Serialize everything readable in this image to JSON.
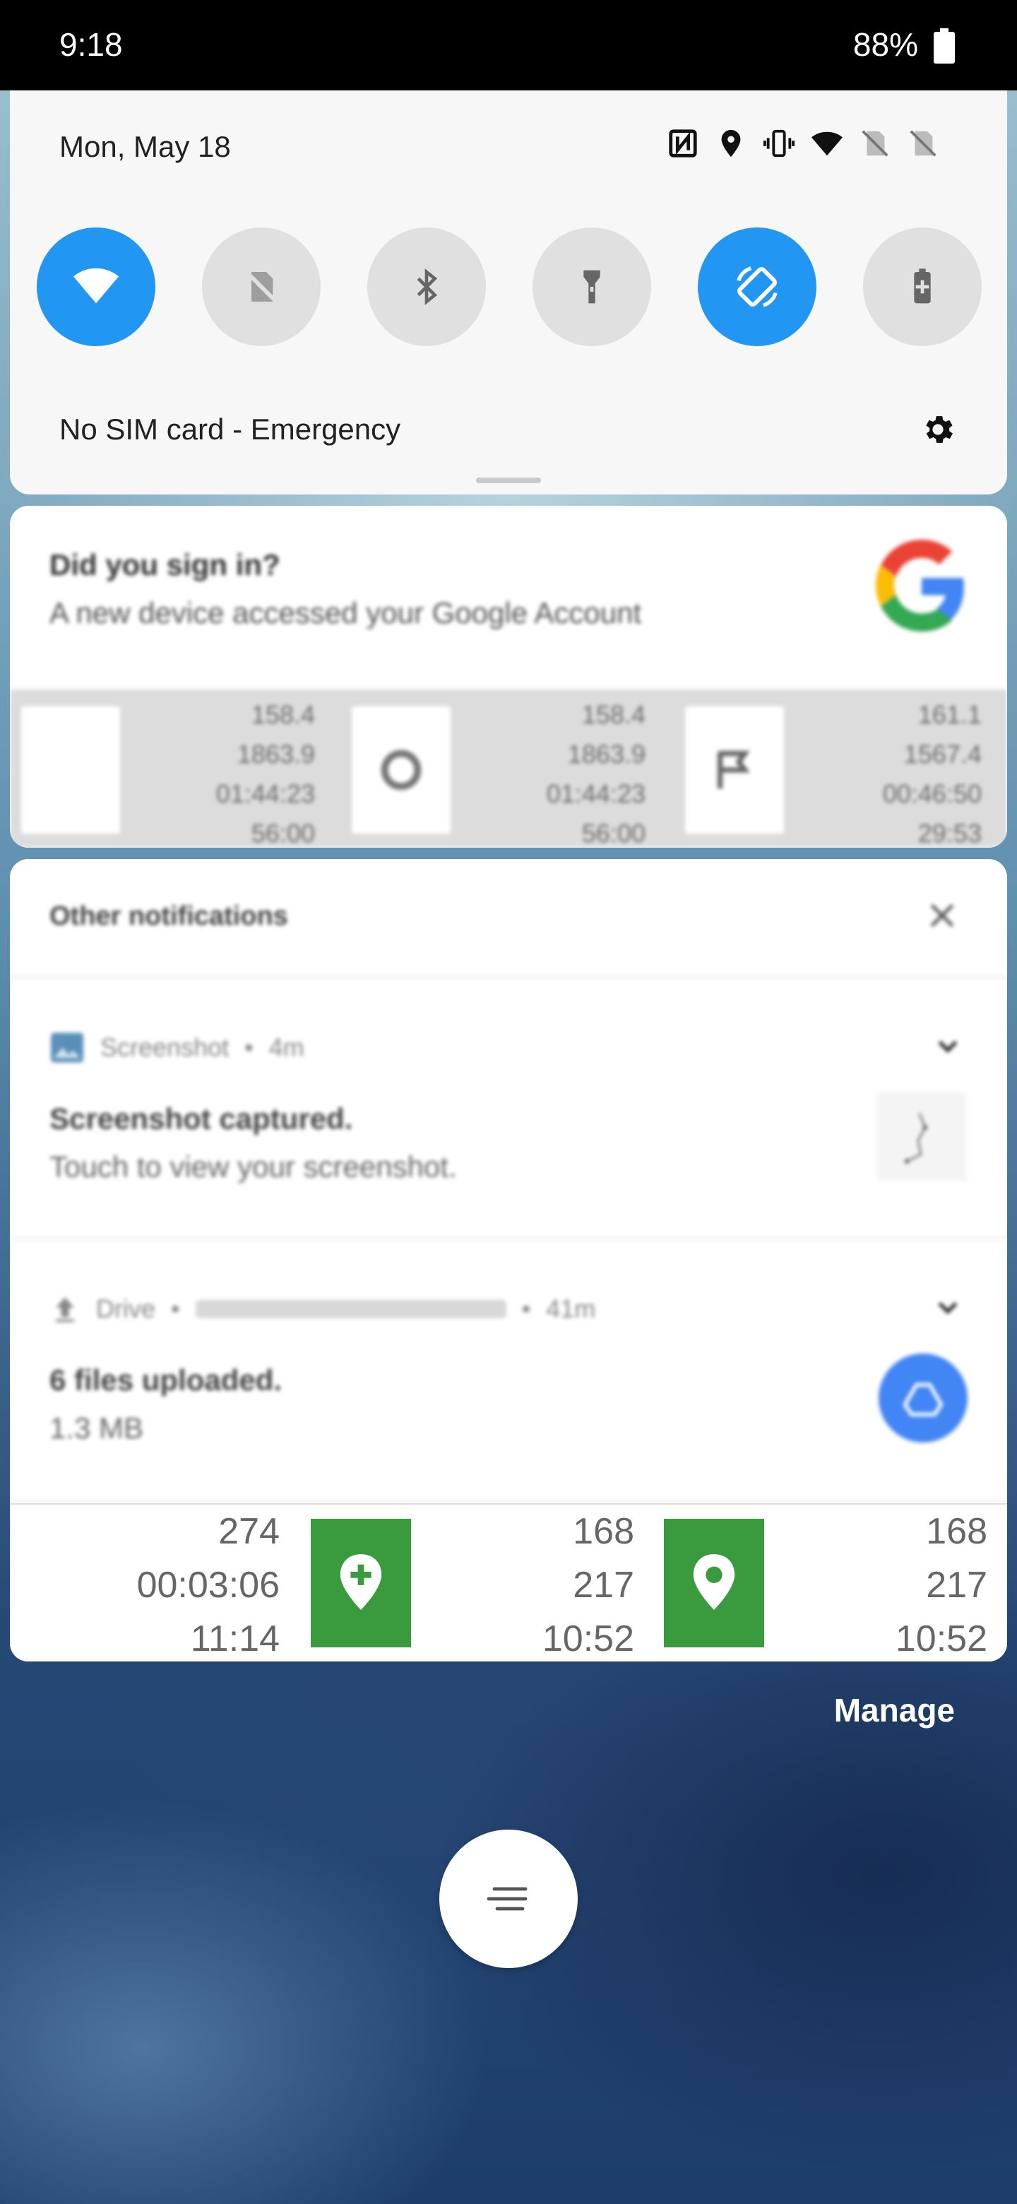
{
  "status_bar": {
    "time": "9:18",
    "battery": "88%"
  },
  "quick_settings": {
    "date": "Mon, May 18",
    "status_icons": [
      "nfc-icon",
      "location-icon",
      "vibrate-icon",
      "wifi-icon",
      "no-sim-icon",
      "no-sim-icon"
    ],
    "tiles": [
      {
        "name": "wifi",
        "on": true
      },
      {
        "name": "mobile-data",
        "on": false
      },
      {
        "name": "bluetooth",
        "on": false
      },
      {
        "name": "flashlight",
        "on": false
      },
      {
        "name": "auto-rotate",
        "on": true
      },
      {
        "name": "battery-saver",
        "on": false
      }
    ],
    "sim_text": "No SIM card - Emergency"
  },
  "google_notification": {
    "title": "Did you sign in?",
    "body": "A new device accessed your Google Account",
    "stats": [
      {
        "values": [
          "158.4",
          "1863.9",
          "01:44:23",
          "56:00"
        ]
      },
      {
        "values": [
          "158.4",
          "1863.9",
          "01:44:23",
          "56:00"
        ]
      },
      {
        "values": [
          "161.1",
          "1567.4",
          "00:46:50",
          "29:53"
        ]
      }
    ]
  },
  "other_notifications": {
    "header": "Other notifications",
    "screenshot": {
      "app": "Screenshot",
      "time": "4m",
      "title": "Screenshot captured.",
      "body": "Touch to view your screenshot."
    },
    "drive": {
      "app": "Drive",
      "time": "41m",
      "title": "6 files uploaded.",
      "body": "1.3 MB"
    }
  },
  "track_stats": [
    [
      "274",
      "00:03:06",
      "11:14"
    ],
    [
      "168",
      "217",
      "10:52"
    ],
    [
      "168",
      "217",
      "10:52"
    ]
  ],
  "manage_label": "Manage",
  "colors": {
    "accent": "#2196f3",
    "pin_green": "#3a9a3e",
    "drive_blue": "#4285f4"
  }
}
